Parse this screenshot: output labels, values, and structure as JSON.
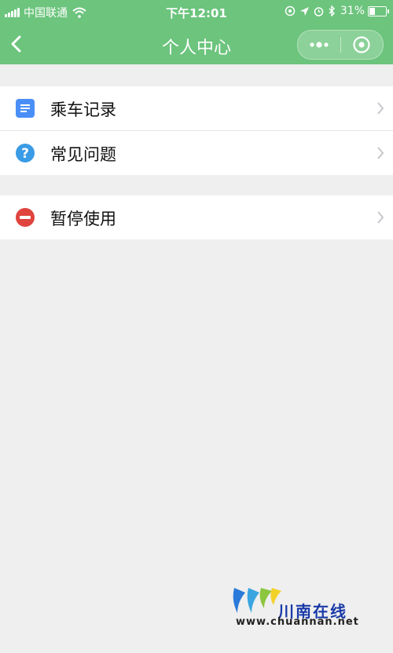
{
  "status_bar": {
    "carrier": "中国联通",
    "time": "下午12:01",
    "battery_percent": "31%",
    "battery_level": 0.31,
    "icons": [
      "signal-icon",
      "wifi-icon",
      "location-lock-icon",
      "navigation-arrow-icon",
      "alarm-icon",
      "bluetooth-icon",
      "battery-icon"
    ]
  },
  "nav": {
    "title": "个人中心",
    "back_icon": "chevron-left-icon",
    "more_icon": "more-dots-icon",
    "close_icon": "target-circle-icon"
  },
  "menu": {
    "group1": [
      {
        "label": "乘车记录",
        "icon": "document-list-icon",
        "icon_color": "#4a8ff7"
      },
      {
        "label": "常见问题",
        "icon": "question-circle-icon",
        "icon_color": "#3a9be6"
      }
    ],
    "group2": [
      {
        "label": "暂停使用",
        "icon": "minus-circle-icon",
        "icon_color": "#e0443e"
      }
    ]
  },
  "watermark": {
    "name": "川南在线",
    "url": "www.chuannan.net"
  },
  "colors": {
    "header_green": "#6cc47d",
    "page_bg": "#efefef"
  }
}
